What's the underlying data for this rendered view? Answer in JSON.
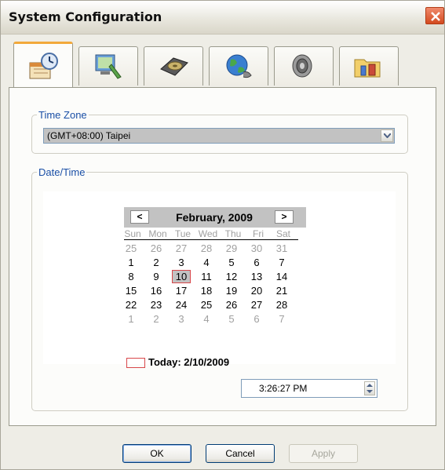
{
  "window": {
    "title": "System Configuration"
  },
  "tabs": [
    {
      "icon": "date-time-icon",
      "active": true
    },
    {
      "icon": "display-settings-icon",
      "active": false
    },
    {
      "icon": "hard-disk-icon",
      "active": false
    },
    {
      "icon": "network-globe-icon",
      "active": false
    },
    {
      "icon": "speaker-icon",
      "active": false
    },
    {
      "icon": "folder-tools-icon",
      "active": false
    }
  ],
  "time_zone": {
    "label": "Time Zone",
    "selected": "(GMT+08:00) Taipei"
  },
  "date_time": {
    "label": "Date/Time",
    "calendar": {
      "prev": "<",
      "next": ">",
      "month_label": "February, 2009",
      "weekdays": [
        "Sun",
        "Mon",
        "Tue",
        "Wed",
        "Thu",
        "Fri",
        "Sat"
      ],
      "weeks": [
        [
          "25",
          "26",
          "27",
          "28",
          "29",
          "30",
          "31"
        ],
        [
          "1",
          "2",
          "3",
          "4",
          "5",
          "6",
          "7"
        ],
        [
          "8",
          "9",
          "10",
          "11",
          "12",
          "13",
          "14"
        ],
        [
          "15",
          "16",
          "17",
          "18",
          "19",
          "20",
          "21"
        ],
        [
          "22",
          "23",
          "24",
          "25",
          "26",
          "27",
          "28"
        ],
        [
          "1",
          "2",
          "3",
          "4",
          "5",
          "6",
          "7"
        ]
      ],
      "selected_day": "10",
      "today_label": "Today: 2/10/2009"
    },
    "time_value": "3:26:27 PM"
  },
  "buttons": {
    "ok": "OK",
    "cancel": "Cancel",
    "apply": "Apply"
  },
  "colors": {
    "group_label": "#1a4fa6",
    "active_tab_accent": "#f2a93b",
    "selection_border": "#d8474a"
  }
}
